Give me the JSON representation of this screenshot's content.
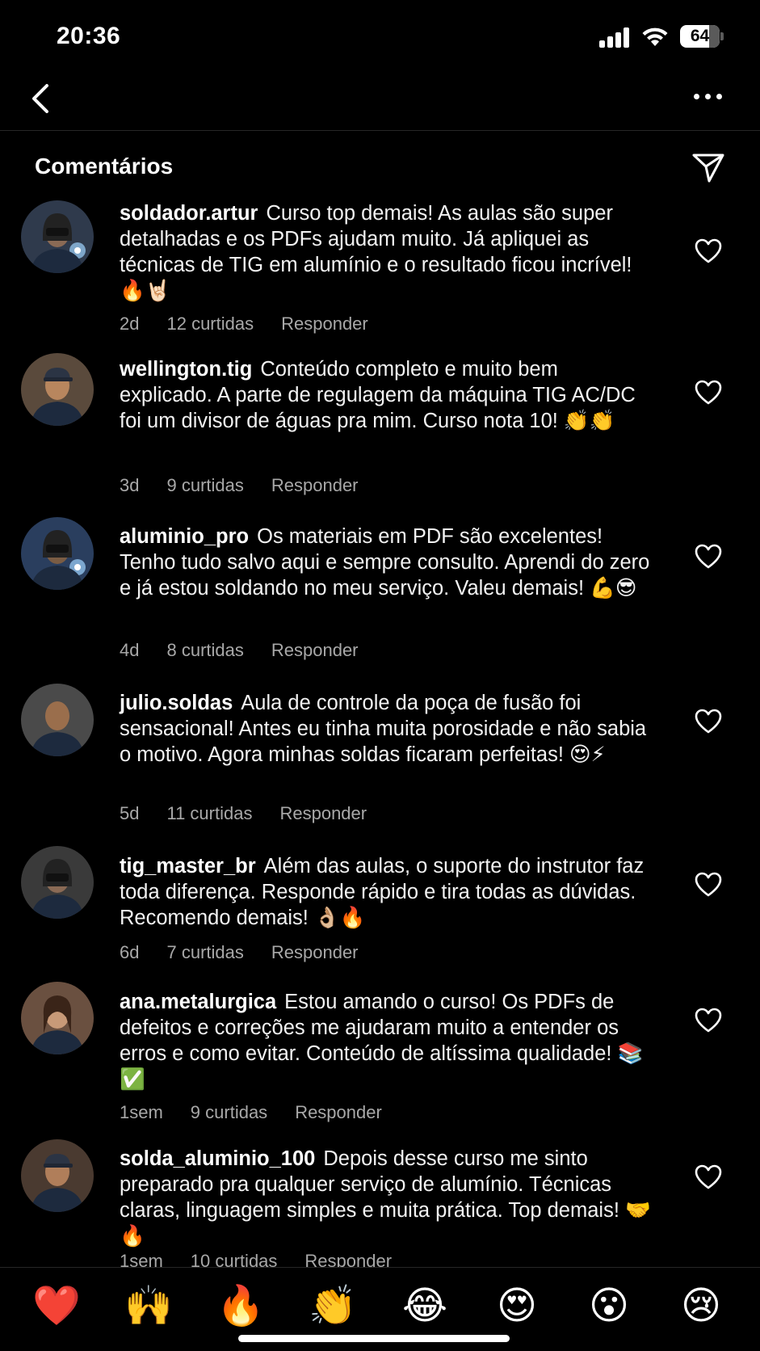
{
  "status_bar": {
    "time": "20:36",
    "battery": "64"
  },
  "header": {
    "title": "Comentários"
  },
  "comments": [
    {
      "username": "soldador.artur",
      "text": "Curso top demais! As aulas são super detalhadas e os PDFs ajudam muito. Já apliquei as técnicas de TIG em alumínio e o resultado ficou incrível! 🔥🤘🏻",
      "age": "2d",
      "likes": "12 curtidas",
      "reply": "Responder"
    },
    {
      "username": "wellington.tig",
      "text": "Conteúdo completo e muito bem explicado. A parte de regulagem da máquina TIG AC/DC foi um divisor de águas pra mim. Curso nota 10! 👏👏",
      "age": "3d",
      "likes": "9 curtidas",
      "reply": "Responder"
    },
    {
      "username": "aluminio_pro",
      "text": "Os materiais em PDF são excelentes! Tenho tudo salvo aqui e sempre consulto. Aprendi do zero e já estou soldando no meu serviço. Valeu demais! 💪😎",
      "age": "4d",
      "likes": "8 curtidas",
      "reply": "Responder"
    },
    {
      "username": "julio.soldas",
      "text": "Aula de controle da poça de fusão foi sensacional! Antes eu tinha muita porosidade e não sabia o motivo. Agora minhas soldas ficaram perfeitas! 😍⚡",
      "age": "5d",
      "likes": "11 curtidas",
      "reply": "Responder"
    },
    {
      "username": "tig_master_br",
      "text": "Além das aulas, o suporte do instrutor faz toda diferença. Responde rápido e tira todas as dúvidas. Recomendo demais! 👌🏼🔥",
      "age": "6d",
      "likes": "7 curtidas",
      "reply": "Responder"
    },
    {
      "username": "ana.metalurgica",
      "text": "Estou amando o curso! Os PDFs de defeitos e correções me ajudaram muito a entender os erros e como evitar. Conteúdo de altíssima qualidade! 📚✅",
      "age": "1sem",
      "likes": "9 curtidas",
      "reply": "Responder"
    },
    {
      "username": "solda_aluminio_100",
      "text": "Depois desse curso me sinto preparado pra qualquer serviço de alumínio. Técnicas claras, linguagem simples e muita prática. Top demais! 🤝🔥",
      "age": "1sem",
      "likes": "10 curtidas",
      "reply": "Responder"
    }
  ],
  "reactions": [
    "❤️",
    "🙌",
    "🔥",
    "👏",
    "😂",
    "😍",
    "😮",
    "😢"
  ],
  "icons": {
    "back": "chevron-left-icon",
    "more": "more-horizontal-icon",
    "share": "paper-plane-icon",
    "like": "heart-outline-icon"
  },
  "colors": {
    "background": "#000000",
    "text": "#ffffff",
    "meta": "#a8a8a8"
  }
}
